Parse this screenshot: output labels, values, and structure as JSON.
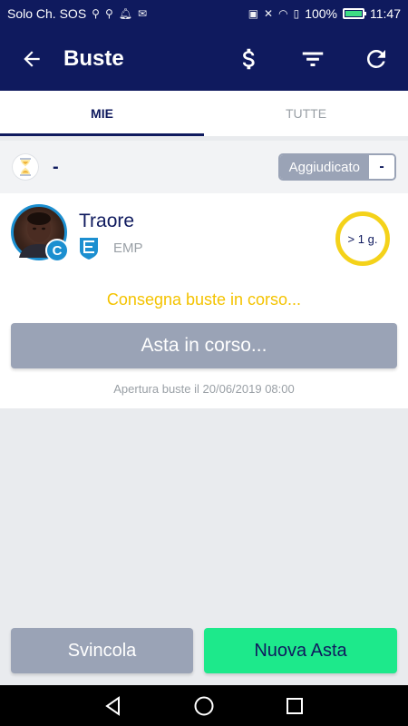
{
  "statusbar": {
    "carrier": "Solo Ch. SOS",
    "battery_percent": "100%",
    "battery_level": 1.0,
    "time": "11:47"
  },
  "appbar": {
    "title": "Buste",
    "back_icon": "arrow-left-icon",
    "actions": [
      "dollar-icon",
      "filter-icon",
      "refresh-icon"
    ]
  },
  "tabs": [
    {
      "label": "MIE",
      "active": true
    },
    {
      "label": "TUTTE",
      "active": false
    }
  ],
  "filter": {
    "status_value": "-",
    "toggle_label": "Aggiudicato",
    "toggle_value": "-"
  },
  "card": {
    "player_name": "Traore",
    "role_badge": "C",
    "team": "EMP",
    "timer": "> 1 g.",
    "status_message": "Consegna buste in corso...",
    "auction_button": "Asta in corso...",
    "opening_text": "Apertura buste il 20/06/2019 08:00"
  },
  "buttons": {
    "release": "Svincola",
    "new_auction": "Nuova Asta"
  },
  "colors": {
    "primary": "#0f1a5e",
    "accent_green": "#1de98b",
    "accent_yellow": "#f4d21a",
    "disabled_gray": "#9aa3b6",
    "role_blue": "#1c8fd0"
  }
}
